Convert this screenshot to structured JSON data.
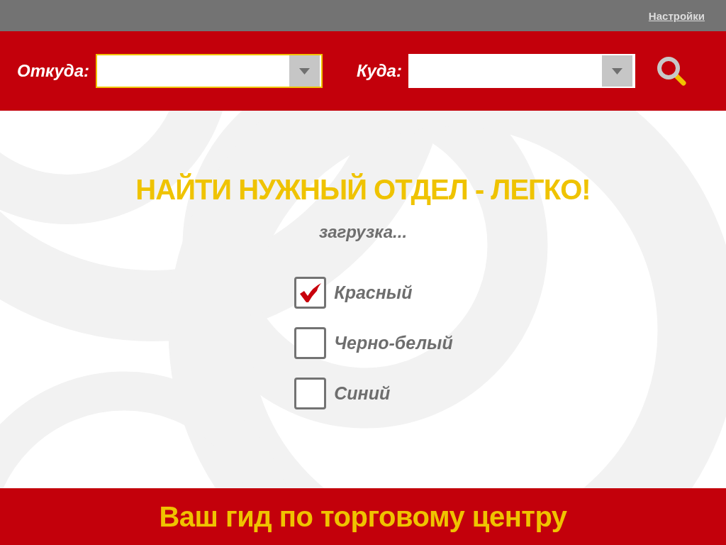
{
  "top_bar": {
    "settings_link": "Настройки"
  },
  "route_bar": {
    "fields": [
      {
        "label": "Откуда:",
        "focused": true
      },
      {
        "label": "Куда:",
        "focused": false
      }
    ]
  },
  "heading": "НАЙТИ НУЖНЫЙ ОТДЕЛ - ЛЕГКО!",
  "status": "загрузка...",
  "color_schemes": [
    {
      "label": "Красный",
      "checked": true
    },
    {
      "label": "Черно-белый",
      "checked": false
    },
    {
      "label": "Синий",
      "checked": false
    }
  ],
  "footer": {
    "text": "Ваш гид по торговому центру"
  }
}
